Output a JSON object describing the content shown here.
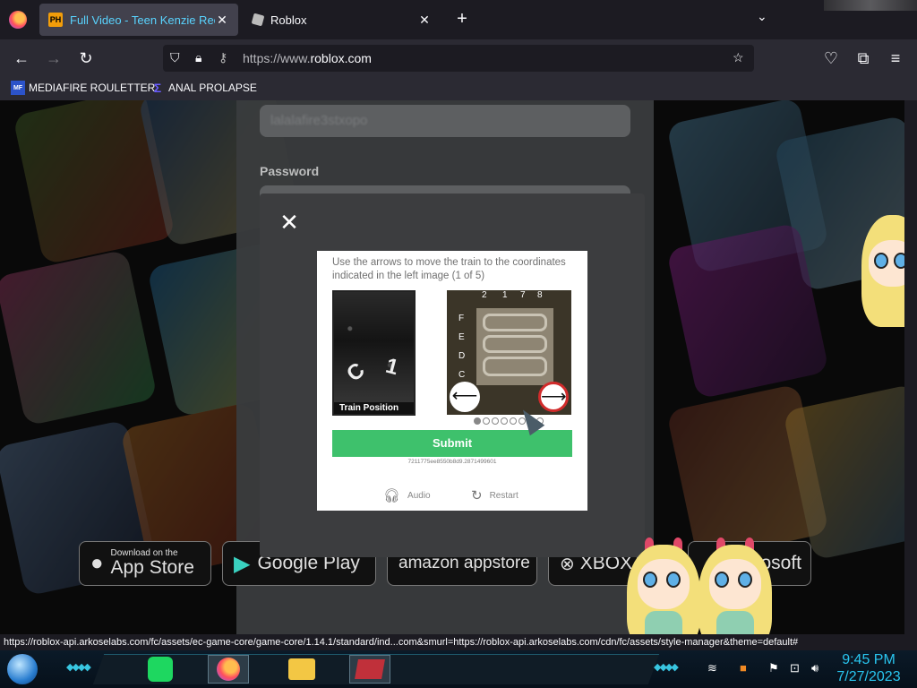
{
  "tabs": [
    {
      "favicon": "PH",
      "title": "Full Video - Teen Kenzie Reeves",
      "close": "✕"
    },
    {
      "favicon": "roblox-icon",
      "title": "Roblox",
      "close": "✕"
    }
  ],
  "new_tab": "+",
  "tab_list": "⌄",
  "nav": {
    "url_scheme": "https://www.",
    "url_host": "roblox.com"
  },
  "bookmarks": [
    {
      "icon": "MF",
      "label": "MEDIAFIRE ROULETTER"
    },
    {
      "icon": "Σ",
      "label": "ANAL PROLAPSE"
    }
  ],
  "login": {
    "username_value": "lalalafire3stxopo",
    "password_label": "Password"
  },
  "stores": [
    {
      "small": "Download on the",
      "large": "App Store"
    },
    {
      "small": "",
      "large": "Google Play"
    },
    {
      "small": "",
      "large": "amazon appstore"
    },
    {
      "small": "",
      "large": "XBOX"
    },
    {
      "small": "",
      "large": "Microsoft"
    }
  ],
  "modal": {
    "close": "✕",
    "instructions": "Use the arrows to move the train to the coordinates indicated in the left image (1 of 5)",
    "left_caption": "Train Position",
    "left_glyphs": [
      "C",
      "1"
    ],
    "top_coords": [
      "2",
      "1",
      "7",
      "8"
    ],
    "side_coords": [
      "F",
      "E",
      "D",
      "C"
    ],
    "arrow_left": "⟵",
    "arrow_right": "⟶",
    "progress": {
      "current": 1,
      "total": 8
    },
    "submit": "Submit",
    "session_id": "7211775ee8550b8d9.2871499601",
    "audio": "Audio",
    "restart": "Restart"
  },
  "status_url": "https://roblox-api.arkoselabs.com/fc/assets/ec-game-core/game-core/1.14.1/standard/ind...com&smurl=https://roblox-api.arkoselabs.com/cdn/fc/assets/style-manager&theme=default#",
  "taskbar": {
    "time": "9:45 PM",
    "date": "7/27/2023"
  },
  "colors": {
    "submit": "#3ec16c",
    "modal_bg": "#3c3d3f",
    "clock": "#29c6f0"
  }
}
